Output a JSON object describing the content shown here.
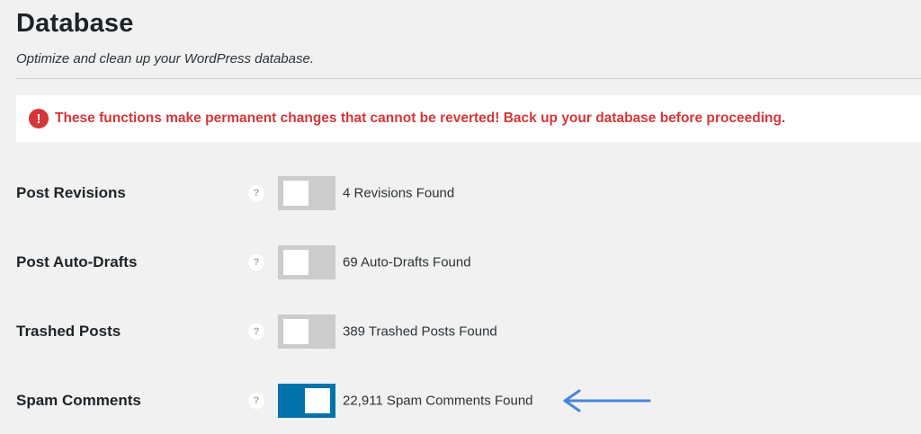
{
  "header": {
    "title": "Database",
    "subtitle": "Optimize and clean up your WordPress database."
  },
  "notice": {
    "icon": "exclamation-icon",
    "icon_glyph": "!",
    "text": "These functions make permanent changes that cannot be reverted! Back up your database before proceeding.",
    "color": "#d63638"
  },
  "help_glyph": "?",
  "colors": {
    "toggle_on": "#0073aa",
    "toggle_off": "#cccccc",
    "annotation_arrow": "#4a85d8"
  },
  "rows": [
    {
      "label": "Post Revisions",
      "status": "4 Revisions Found",
      "enabled": false
    },
    {
      "label": "Post Auto-Drafts",
      "status": "69 Auto-Drafts Found",
      "enabled": false
    },
    {
      "label": "Trashed Posts",
      "status": "389 Trashed Posts Found",
      "enabled": false
    },
    {
      "label": "Spam Comments",
      "status": "22,911 Spam Comments Found",
      "enabled": true
    }
  ]
}
